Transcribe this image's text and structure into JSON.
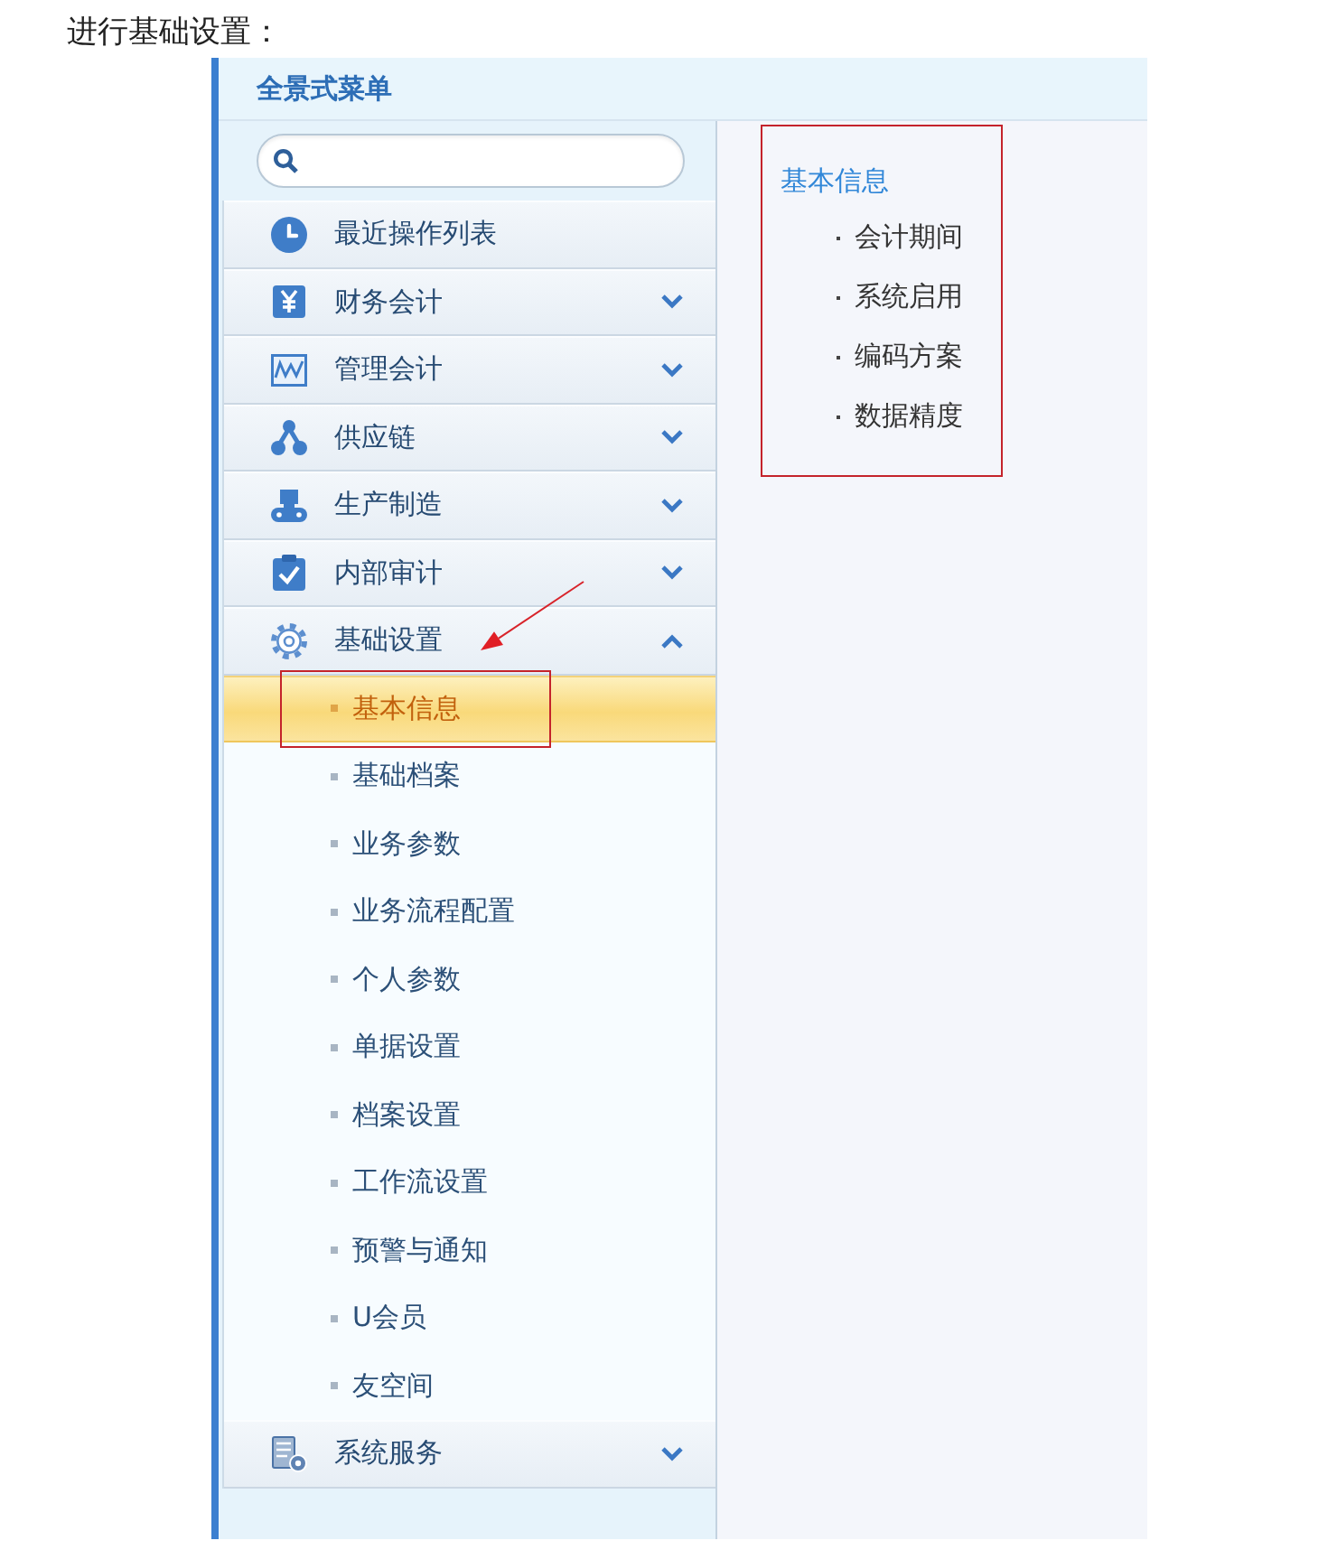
{
  "caption": "进行基础设置：",
  "menu_header": {
    "title": "全景式菜单"
  },
  "menu": [
    {
      "label": "最近操作列表",
      "kind": "link"
    },
    {
      "label": "财务会计",
      "kind": "group",
      "expanded": false
    },
    {
      "label": "管理会计",
      "kind": "group",
      "expanded": false
    },
    {
      "label": "供应链",
      "kind": "group",
      "expanded": false
    },
    {
      "label": "生产制造",
      "kind": "group",
      "expanded": false
    },
    {
      "label": "内部审计",
      "kind": "group",
      "expanded": false
    },
    {
      "label": "基础设置",
      "kind": "group",
      "expanded": true,
      "children": [
        {
          "label": "基本信息",
          "selected": true
        },
        {
          "label": "基础档案",
          "selected": false
        },
        {
          "label": "业务参数",
          "selected": false
        },
        {
          "label": "业务流程配置",
          "selected": false
        },
        {
          "label": "个人参数",
          "selected": false
        },
        {
          "label": "单据设置",
          "selected": false
        },
        {
          "label": "档案设置",
          "selected": false
        },
        {
          "label": "工作流设置",
          "selected": false
        },
        {
          "label": "预警与通知",
          "selected": false
        },
        {
          "label": "U会员",
          "selected": false
        },
        {
          "label": "友空间",
          "selected": false
        }
      ]
    },
    {
      "label": "系统服务",
      "kind": "group",
      "expanded": false
    }
  ],
  "detail_panel": {
    "title": "基本信息",
    "items": [
      "会计期间",
      "系统启用",
      "编码方案",
      "数据精度"
    ]
  }
}
